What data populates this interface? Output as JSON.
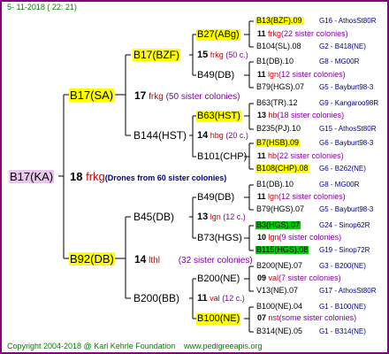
{
  "header": {
    "date": "5- 11-2018 ( 22: 21)"
  },
  "footer": {
    "copyright": "Copyright 2004-2018 @ Karl Kehrle Foundation",
    "website": "www.pedigreeapis.org"
  },
  "root": {
    "code": "B17(KA)",
    "num": "18",
    "abbr": "frkg",
    "note": "(Drones from 60 sister colonies)"
  },
  "gen1": [
    {
      "code": "B17(SA)",
      "num": "17",
      "abbr": "frkg",
      "note": "(50 sister colonies)"
    },
    {
      "code": "B92(DB)",
      "num": "14",
      "abbr": "lthl",
      "note": "(32 sister colonies)"
    }
  ],
  "gen2": [
    {
      "code": "B17(BZF)",
      "num": "15",
      "abbr": "frkg",
      "note": "(50 c.)"
    },
    {
      "code": "B144(HST)",
      "num": "14",
      "abbr": "hbg",
      "note": "(20 c.)"
    },
    {
      "code": "B45(DB)",
      "num": "13",
      "abbr": "lgn",
      "note": "(12 c.)"
    },
    {
      "code": "B200(BB)",
      "num": "11",
      "abbr": "val",
      "note": "(12 c.)"
    }
  ],
  "gen3": [
    {
      "code": "B27(ABg)",
      "num": "11",
      "abbr": "frkg",
      "note": "(22 sister colonies)"
    },
    {
      "code": "B49(DB)",
      "num": "11",
      "abbr": "lgn",
      "note": "(12 sister colonies)"
    },
    {
      "code": "B63(HST)",
      "num": "13",
      "abbr": "hb",
      "note": "(18 sister colonies)"
    },
    {
      "code": "B101(CHP)",
      "num": "11",
      "abbr": "hb",
      "note": "(22 sister colonies)"
    },
    {
      "code": "B49(DB)",
      "num": "11",
      "abbr": "lgn",
      "note": "(12 sister colonies)"
    },
    {
      "code": "B73(HGS)",
      "num": "10",
      "abbr": "lgn",
      "note": "(9 sister colonies)"
    },
    {
      "code": "B200(NE)",
      "num": "09",
      "abbr": "val",
      "note": "(7 sister colonies)"
    },
    {
      "code": "B100(NE)",
      "num": "07",
      "abbr": "nst",
      "note": "(some sister colonies)"
    }
  ],
  "gen4": [
    {
      "code": "B13(BZF).09",
      "info": "G16 - AthosSt80R"
    },
    {
      "code": "B104(SL).08",
      "info": "G2 - B418(NE)"
    },
    {
      "code": "B1(DB).10",
      "info": "G8 - MG00R"
    },
    {
      "code": "B79(HGS).07",
      "info": "G5 - Bayburt98-3"
    },
    {
      "code": "B63(TR).12",
      "info": "G9 - Kangaroo98R"
    },
    {
      "code": "B235(PJ).10",
      "info": "G15 - AthosSt80R"
    },
    {
      "code": "B7(HSB).09",
      "info": "G6 - Bayburt98-3"
    },
    {
      "code": "B108(CHP).08",
      "info": "G6 - B262(NE)"
    },
    {
      "code": "B1(DB).10",
      "info": "G8 - MG00R"
    },
    {
      "code": "B79(HGS).07",
      "info": "G5 - Bayburt98-3"
    },
    {
      "code": "B3(HGS).07",
      "info": "G24 - Sinop62R"
    },
    {
      "code": "B115(HGS).08",
      "info": "G19 - Sinop72R"
    },
    {
      "code": "B200(NE).07",
      "info": "G3 - B200(NE)"
    },
    {
      "code": "V13(NE).07",
      "info": "G17 - AthosSt80R"
    },
    {
      "code": "B100(NE).04",
      "info": "G1 - B100(NE)"
    },
    {
      "code": "B314(NE).05",
      "info": "G1 - B314(NE)"
    }
  ],
  "colors": {
    "frame": "#800080",
    "highlight_yellow": "#ffff00",
    "highlight_green": "#00cc00",
    "highlight_root": "#e8c8e8",
    "link": "#000080",
    "text_green": "#008000",
    "abbr_red": "#cc0000",
    "sister_purple": "#8000a0"
  }
}
